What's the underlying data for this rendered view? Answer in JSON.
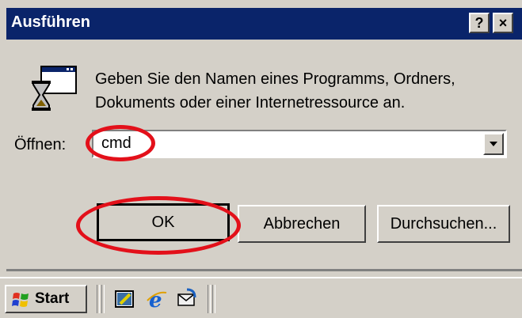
{
  "window": {
    "title": "Ausführen",
    "help_button": "?",
    "close_button": "×"
  },
  "dialog": {
    "description_line1": "Geben Sie den Namen eines Programms, Ordners,",
    "description_line2": "Dokuments oder einer Internetressource an.",
    "open_label": "Öffnen:",
    "open_value": "cmd",
    "buttons": {
      "ok": "OK",
      "cancel": "Abbrechen",
      "browse": "Durchsuchen..."
    }
  },
  "taskbar": {
    "start_label": "Start",
    "quick_launch": [
      "show-desktop-icon",
      "internet-explorer-icon",
      "outlook-express-icon"
    ]
  },
  "colors": {
    "title_bar": "#0a246a",
    "face": "#d4d0c8",
    "highlight_ring": "#e3101a"
  }
}
